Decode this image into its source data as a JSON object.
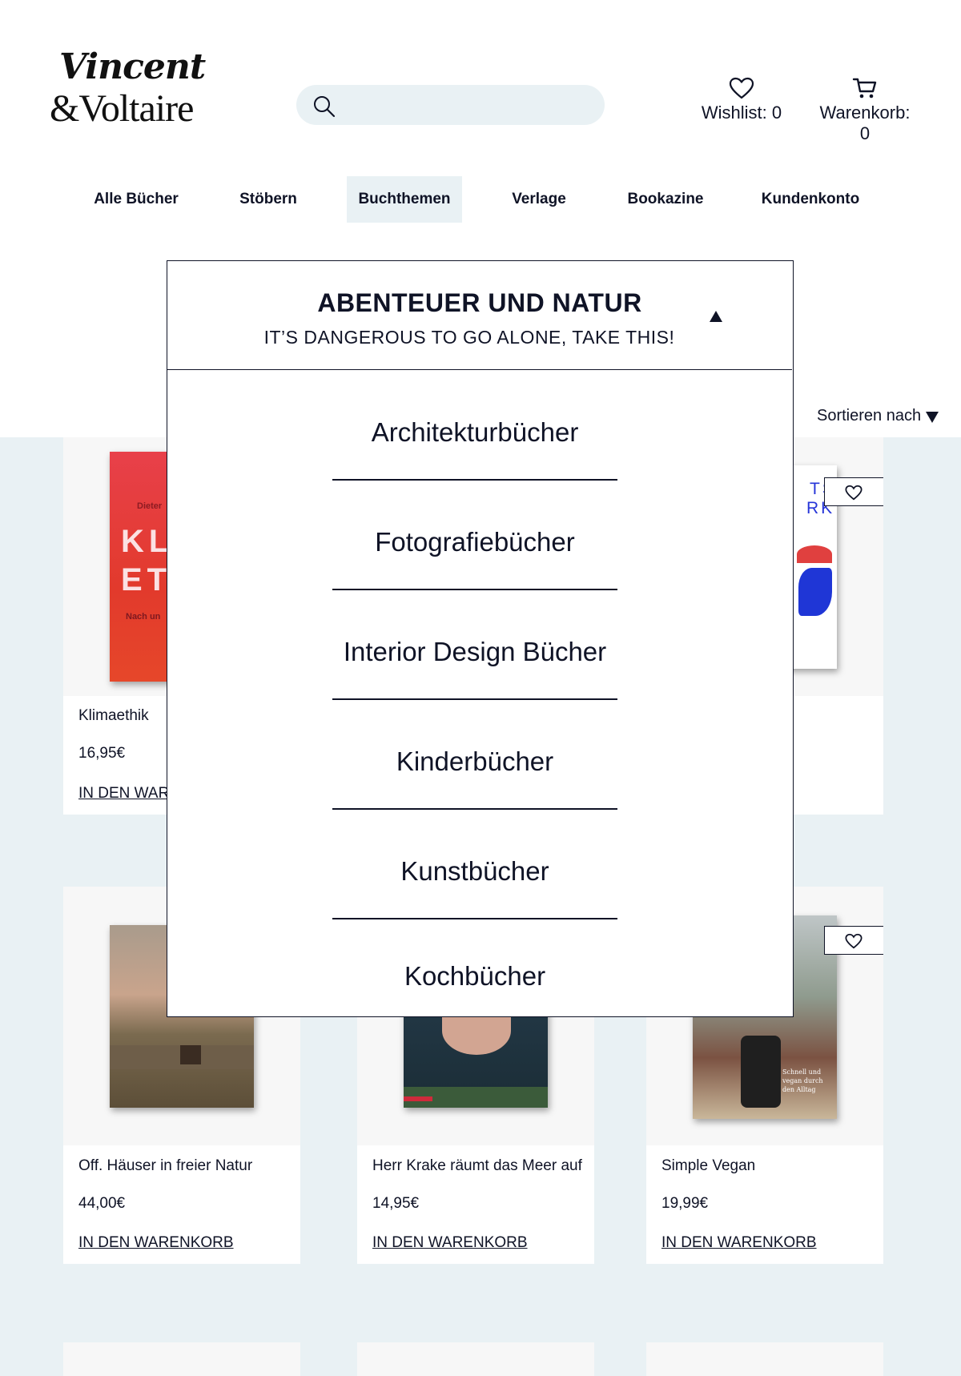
{
  "header": {
    "logo_line1": "Vincent",
    "logo_line2": "&Voltaire",
    "search": {
      "value": "",
      "placeholder": ""
    },
    "wishlist_label": "Wishlist: 0",
    "cart_label": "Warenkorb: 0"
  },
  "nav": {
    "items": [
      {
        "label": "Alle Bücher"
      },
      {
        "label": "Stöbern"
      },
      {
        "label": "Buchthemen"
      },
      {
        "label": "Verlage"
      },
      {
        "label": "Bookazine"
      },
      {
        "label": "Kundenkonto"
      }
    ],
    "active": "Buchthemen"
  },
  "sort": {
    "label": "Sortieren nach"
  },
  "dropdown": {
    "title": "ABENTEUER UND NATUR",
    "subtitle": "IT’S DANGEROUS TO GO ALONE, TAKE THIS!",
    "items": [
      {
        "label": "Architekturbücher"
      },
      {
        "label": "Fotografiebücher"
      },
      {
        "label": "Interior Design Bücher"
      },
      {
        "label": "Kinderbücher"
      },
      {
        "label": "Kunstbücher"
      },
      {
        "label": "Kochbücher"
      }
    ]
  },
  "products": [
    {
      "title": "Klimaethik",
      "price": "16,95€",
      "cta": "IN DEN WARENKORB",
      "cover_text": [
        "Dieter",
        "KL",
        "ET",
        "Nach un"
      ]
    },
    {
      "title": "",
      "price": "",
      "cta": "",
      "cover_text": [
        "TS",
        "RK"
      ]
    },
    {
      "title": "Off. Häuser in freier Natur",
      "price": "44,00€",
      "cta": "IN DEN WARENKORB"
    },
    {
      "title": "Herr Krake räumt das Meer auf",
      "price": "14,95€",
      "cta": "IN DEN WARENKORB"
    },
    {
      "title": "Simple Vegan",
      "price": "19,99€",
      "cta": "IN DEN WARENKORB",
      "cover_text": [
        "Schnell und vegan durch den Alltag"
      ]
    }
  ],
  "colors": {
    "text": "#0f1326",
    "band": "#e9f1f4",
    "nav_active": "#e9f1f4"
  }
}
